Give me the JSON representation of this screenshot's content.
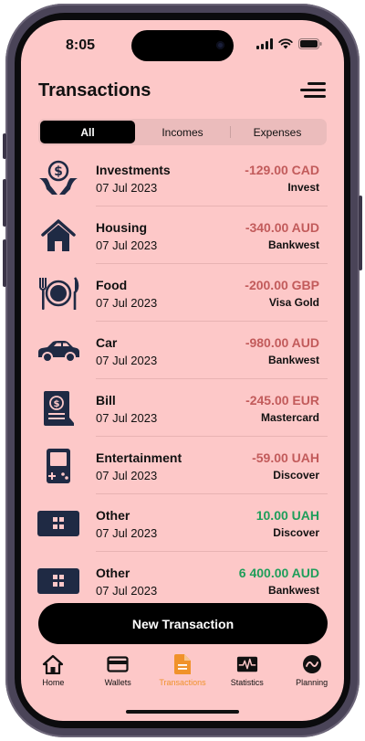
{
  "status_bar": {
    "time": "8:05"
  },
  "header": {
    "title": "Transactions"
  },
  "filter": {
    "options": [
      "All",
      "Incomes",
      "Expenses"
    ],
    "selected": "All"
  },
  "colors": {
    "background": "#fdc8c8",
    "expense": "#c25b5b",
    "income": "#1f9e5a",
    "accent": "#f0922a",
    "icon": "#1f2a44"
  },
  "transactions": [
    {
      "icon": "investment-icon",
      "name": "Investments",
      "date": "07 Jul 2023",
      "amount": "-129.00 CAD",
      "type": "expense",
      "account": "Invest"
    },
    {
      "icon": "house-icon",
      "name": "Housing",
      "date": "07 Jul 2023",
      "amount": "-340.00 AUD",
      "type": "expense",
      "account": "Bankwest"
    },
    {
      "icon": "plate-cutlery-icon",
      "name": "Food",
      "date": "07 Jul 2023",
      "amount": "-200.00 GBP",
      "type": "expense",
      "account": "Visa Gold"
    },
    {
      "icon": "car-icon",
      "name": "Car",
      "date": "07 Jul 2023",
      "amount": "-980.00 AUD",
      "type": "expense",
      "account": "Bankwest"
    },
    {
      "icon": "bill-icon",
      "name": "Bill",
      "date": "07 Jul 2023",
      "amount": "-245.00 EUR",
      "type": "expense",
      "account": "Mastercard"
    },
    {
      "icon": "game-console-icon",
      "name": "Entertainment",
      "date": "07 Jul 2023",
      "amount": "-59.00 UAH",
      "type": "expense",
      "account": "Discover"
    },
    {
      "icon": "grid-card-icon",
      "name": "Other",
      "date": "07 Jul 2023",
      "amount": "10.00 UAH",
      "type": "income",
      "account": "Discover"
    },
    {
      "icon": "grid-card-icon",
      "name": "Other",
      "date": "07 Jul 2023",
      "amount": "6 400.00 AUD",
      "type": "income",
      "account": "Bankwest"
    }
  ],
  "actions": {
    "new_transaction": "New Transaction"
  },
  "tabbar": {
    "items": [
      {
        "label": "Home",
        "icon": "home-icon",
        "active": false
      },
      {
        "label": "Wallets",
        "icon": "wallet-icon",
        "active": false
      },
      {
        "label": "Transactions",
        "icon": "document-icon",
        "active": true
      },
      {
        "label": "Statistics",
        "icon": "pulse-chart-icon",
        "active": false
      },
      {
        "label": "Planning",
        "icon": "planning-icon",
        "active": false
      }
    ]
  }
}
